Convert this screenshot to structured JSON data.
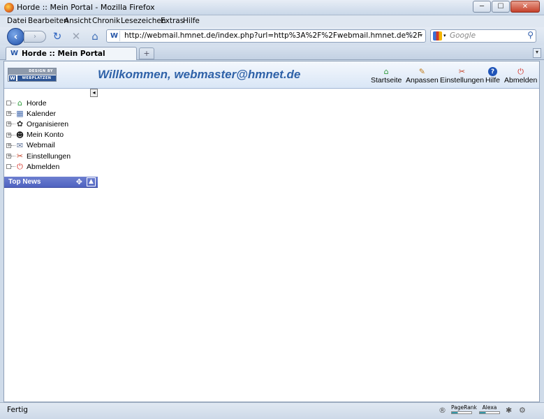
{
  "window": {
    "title": "Horde :: Mein Portal - Mozilla Firefox",
    "minimize": "─",
    "maximize": "☐",
    "close": "✕"
  },
  "menu": [
    "Datei",
    "Bearbeiten",
    "Ansicht",
    "Chronik",
    "Lesezeichen",
    "Extras",
    "Hilfe"
  ],
  "nav": {
    "back": "‹",
    "forward": "›",
    "reload": "↻",
    "stop": "✕",
    "home": "⌂",
    "site_badge": "W",
    "url": "http://webmail.hmnet.de/index.php?url=http%3A%2F%2Fwebmail.hmnet.de%2F",
    "bookmark_star": "☆",
    "dropdown": "▾",
    "search_placeholder": "Google",
    "search_go": "⚲"
  },
  "tabs": {
    "active": "Horde :: Mein Portal",
    "site_badge": "W",
    "new_tab": "+",
    "list": "▾"
  },
  "horde": {
    "logo_top": "DESIGN BY",
    "logo_w": "W",
    "logo_bottom": "WEBPLATZEN",
    "welcome": "Willkommen, webmaster@hmnet.de",
    "topnav": [
      {
        "label": "Startseite",
        "icon": "home-icon",
        "glyph": "⌂",
        "color": "#2d9b3a"
      },
      {
        "label": "Anpassen",
        "icon": "customize-icon",
        "glyph": "✎",
        "color": "#c07a18"
      },
      {
        "label": "Einstellungen",
        "icon": "settings-icon",
        "glyph": "✂",
        "color": "#c23b1f"
      },
      {
        "label": "Hilfe",
        "icon": "help-icon",
        "glyph": "?",
        "color": "#1f54b8"
      },
      {
        "label": "Abmelden",
        "icon": "logout-icon",
        "glyph": "⏻",
        "color": "#d32a1f"
      }
    ],
    "tree_toggle": "◂",
    "tree": [
      {
        "label": "Horde",
        "icon": "horde-icon",
        "glyph": "⌂",
        "color": "#2d9b3a",
        "exp": ""
      },
      {
        "label": "Kalender",
        "icon": "calendar-icon",
        "glyph": "▦",
        "color": "#4a6fb0",
        "exp": "+"
      },
      {
        "label": "Organisieren",
        "icon": "organize-icon",
        "glyph": "✿",
        "color": "#333",
        "exp": "+"
      },
      {
        "label": "Mein Konto",
        "icon": "account-icon",
        "glyph": "☻",
        "color": "#222",
        "exp": "+"
      },
      {
        "label": "Webmail",
        "icon": "mail-icon",
        "glyph": "✉",
        "color": "#5a6f96",
        "exp": "+"
      },
      {
        "label": "Einstellungen",
        "icon": "settings-icon",
        "glyph": "✂",
        "color": "#c23b1f",
        "exp": "+"
      },
      {
        "label": "Abmelden",
        "icon": "logout-icon",
        "glyph": "⏻",
        "color": "#d32a1f",
        "exp": ""
      }
    ],
    "top_news": {
      "title": "Top News",
      "settings_glyph": "✥",
      "collapse_glyph": "▲"
    }
  },
  "status": {
    "text": "Fertig",
    "pagerank": "PageRank",
    "alexa": "Alexa"
  }
}
